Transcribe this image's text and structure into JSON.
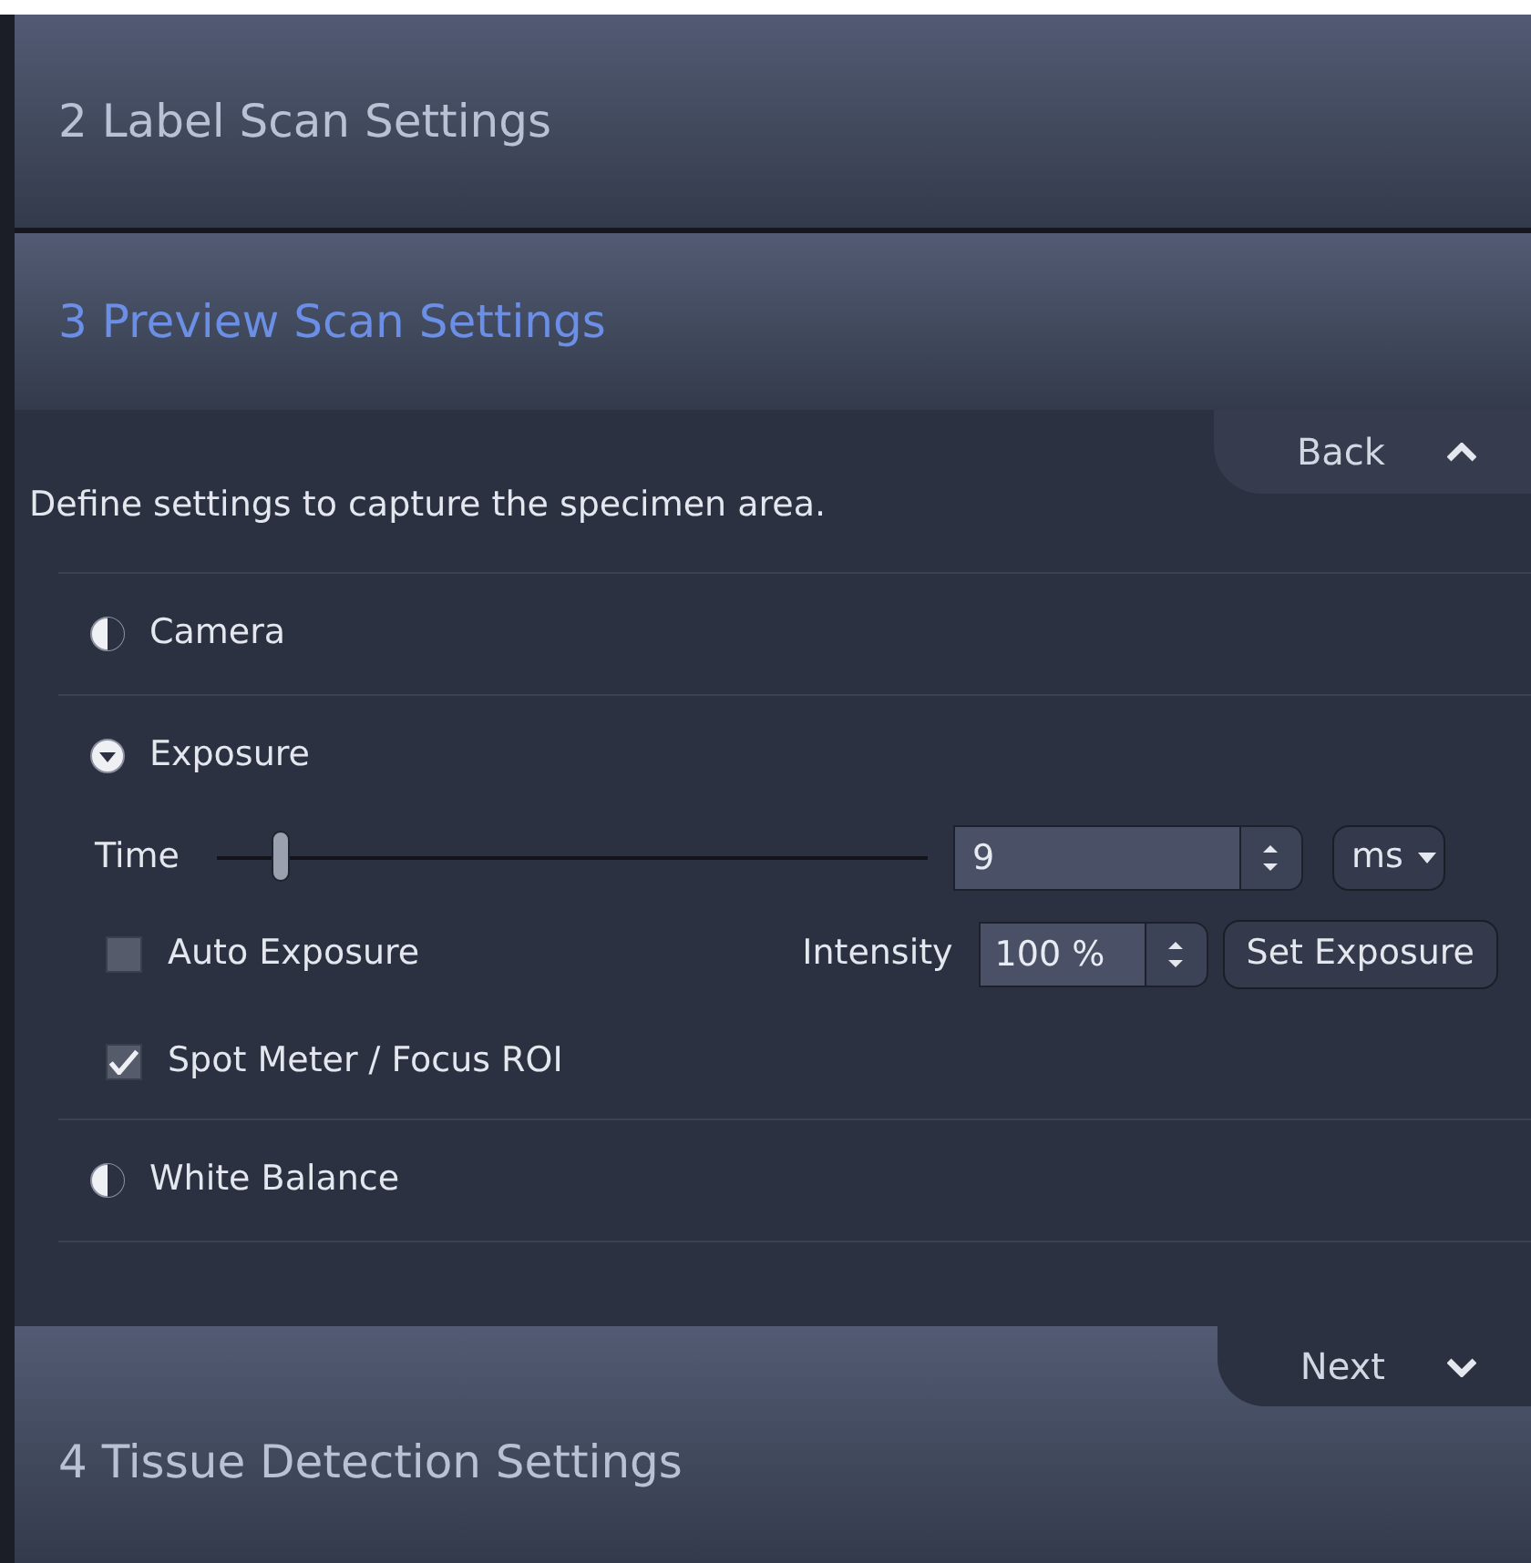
{
  "steps": [
    {
      "title": "2 Label Scan Settings",
      "selected": false
    },
    {
      "title": "3 Preview Scan Settings",
      "selected": true
    },
    {
      "title": "4 Tissue Detection Settings",
      "selected": false
    }
  ],
  "panel": {
    "back": "Back",
    "description": "Define settings to capture the specimen area.",
    "next": "Next",
    "groups": [
      {
        "label": "Camera",
        "expanded": false
      },
      {
        "label": "Exposure",
        "expanded": true
      },
      {
        "label": "White Balance",
        "expanded": false
      }
    ]
  },
  "exposure": {
    "time": {
      "label": "Time",
      "level": 0.09,
      "value": "9",
      "unit": "ms"
    },
    "auto_exposure": {
      "label": "Auto Exposure",
      "checked": false
    },
    "intensity": {
      "label": "Intensity",
      "value": "100 %"
    },
    "set_button": "Set Exposure",
    "spot_meter": {
      "label": "Spot Meter / Focus ROI",
      "checked": true
    }
  }
}
